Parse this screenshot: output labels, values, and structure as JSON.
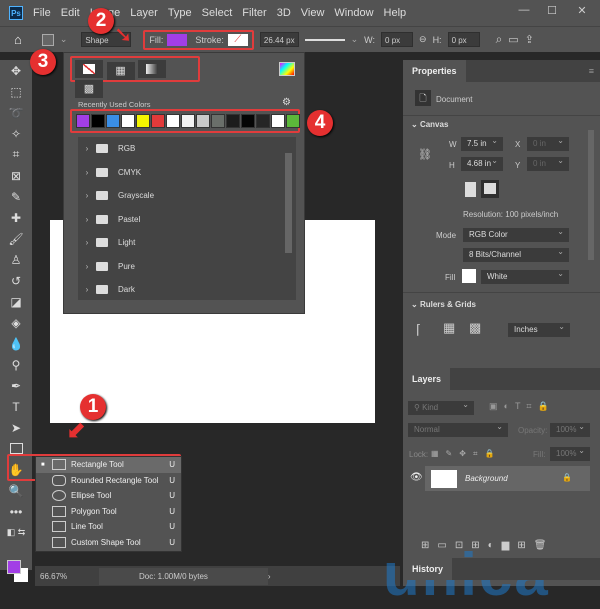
{
  "menu": {
    "app_icon": "Ps",
    "items": [
      "File",
      "Edit",
      "Image",
      "Layer",
      "Type",
      "Select",
      "Filter",
      "3D",
      "View",
      "Window",
      "Help"
    ],
    "window_controls": [
      "minimize",
      "maximize",
      "close"
    ]
  },
  "options": {
    "mode": "Shape",
    "fill_label": "Fill:",
    "fill_color": "#a23ee6",
    "stroke_label": "Stroke:",
    "stroke_width": "26.44 px",
    "w_label": "W:",
    "w_value": "0 px",
    "h_label": "H:",
    "h_value": "0 px"
  },
  "popup": {
    "tabs": [
      "no-color",
      "solid-color",
      "gradient",
      "pattern"
    ],
    "recent_label": "Recently Used Colors",
    "swatches": [
      "#a23ee6",
      "#000000",
      "#3a8ee6",
      "#ffffff",
      "#f5f500",
      "#e23a3a",
      "#ffffff",
      "#f3f3f3",
      "#c9c9c9",
      "#6a6f6a",
      "#1c1c1c",
      "#050505",
      "#262626",
      "#ffffff",
      "#5cb83a"
    ],
    "folders": [
      "RGB",
      "CMYK",
      "Grayscale",
      "Pastel",
      "Light",
      "Pure",
      "Dark"
    ]
  },
  "badges": {
    "b1": "1",
    "b2": "2",
    "b3": "3",
    "b4": "4"
  },
  "properties": {
    "title": "Properties",
    "doc_label": "Document",
    "canvas_title": "Canvas",
    "w_label": "W",
    "w_value": "7.5 in",
    "h_label": "H",
    "h_value": "4.68 in",
    "x_label": "X",
    "x_value": "0 in",
    "y_label": "Y",
    "y_value": "0 in",
    "resolution": "Resolution: 100 pixels/inch",
    "mode_label": "Mode",
    "mode_value": "RGB Color",
    "bits_value": "8 Bits/Channel",
    "fill_label": "Fill",
    "fill_value": "White",
    "rulers_title": "Rulers & Grids",
    "units_value": "Inches"
  },
  "layers": {
    "title": "Layers",
    "kind_placeholder": "Kind",
    "blend": "Normal",
    "opacity_label": "Opacity:",
    "opacity_value": "100%",
    "lock_label": "Lock:",
    "fill_label": "Fill:",
    "fill_value": "100%",
    "layer_name": "Background",
    "history_title": "History"
  },
  "flyout": [
    {
      "label": "Rectangle Tool",
      "shortcut": "U"
    },
    {
      "label": "Rounded Rectangle Tool",
      "shortcut": "U"
    },
    {
      "label": "Ellipse Tool",
      "shortcut": "U"
    },
    {
      "label": "Polygon Tool",
      "shortcut": "U"
    },
    {
      "label": "Line Tool",
      "shortcut": "U"
    },
    {
      "label": "Custom Shape Tool",
      "shortcut": "U"
    }
  ],
  "status": {
    "zoom": "66.67%",
    "doc": "Doc: 1.00M/0 bytes"
  },
  "watermark": "unica",
  "colors": {
    "foreground": "#a23ee6",
    "background": "#ffffff"
  }
}
